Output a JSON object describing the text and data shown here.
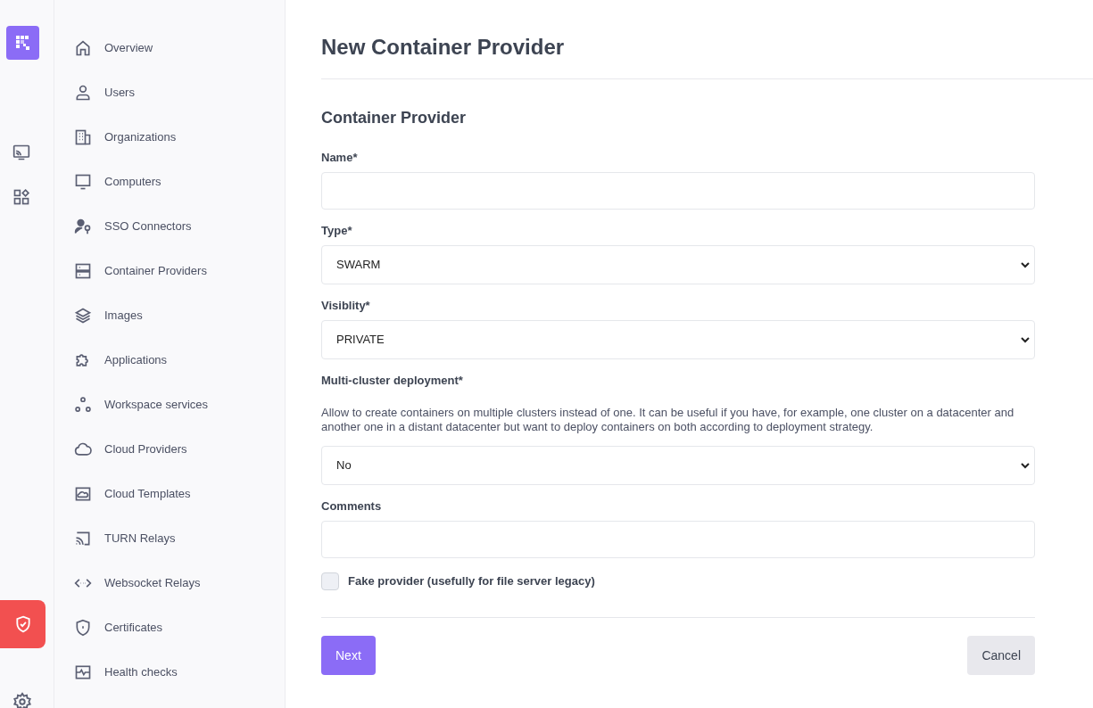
{
  "nav": [
    {
      "label": "Overview",
      "selected": false
    },
    {
      "label": "Users",
      "selected": false
    },
    {
      "label": "Organizations",
      "selected": false
    },
    {
      "label": "Computers",
      "selected": false
    },
    {
      "label": "SSO Connectors",
      "selected": false
    },
    {
      "label": "Container Providers",
      "selected": false
    },
    {
      "label": "Images",
      "selected": false
    },
    {
      "label": "Applications",
      "selected": false
    },
    {
      "label": "Workspace services",
      "selected": false
    },
    {
      "label": "Cloud Providers",
      "selected": false
    },
    {
      "label": "Cloud Templates",
      "selected": false
    },
    {
      "label": "TURN Relays",
      "selected": false
    },
    {
      "label": "Websocket Relays",
      "selected": false
    },
    {
      "label": "Certificates",
      "selected": false
    },
    {
      "label": "Health checks",
      "selected": false
    }
  ],
  "page_title": "New Container Provider",
  "section_title": "Container Provider",
  "fields": [
    {
      "kind": "input",
      "label": "Name*"
    },
    {
      "kind": "select",
      "label": "Type*",
      "value": "SWARM"
    },
    {
      "kind": "select",
      "label": "Visiblity*",
      "value": "PRIVATE"
    },
    {
      "kind": "select",
      "label": "Multi-cluster deployment*",
      "description": "Allow to create containers on multiple clusters instead of one. It can be useful if you have, for example, one cluster on a datacenter and another one in a distant datacenter but want to deploy containers on both according to deployment strategy.",
      "value": "No"
    },
    {
      "kind": "input",
      "label": "Comments"
    },
    {
      "kind": "checkbox",
      "label": "Fake provider (usefully for file server legacy)",
      "checked": false
    }
  ],
  "buttons": {
    "next": "Next",
    "cancel": "Cancel"
  }
}
